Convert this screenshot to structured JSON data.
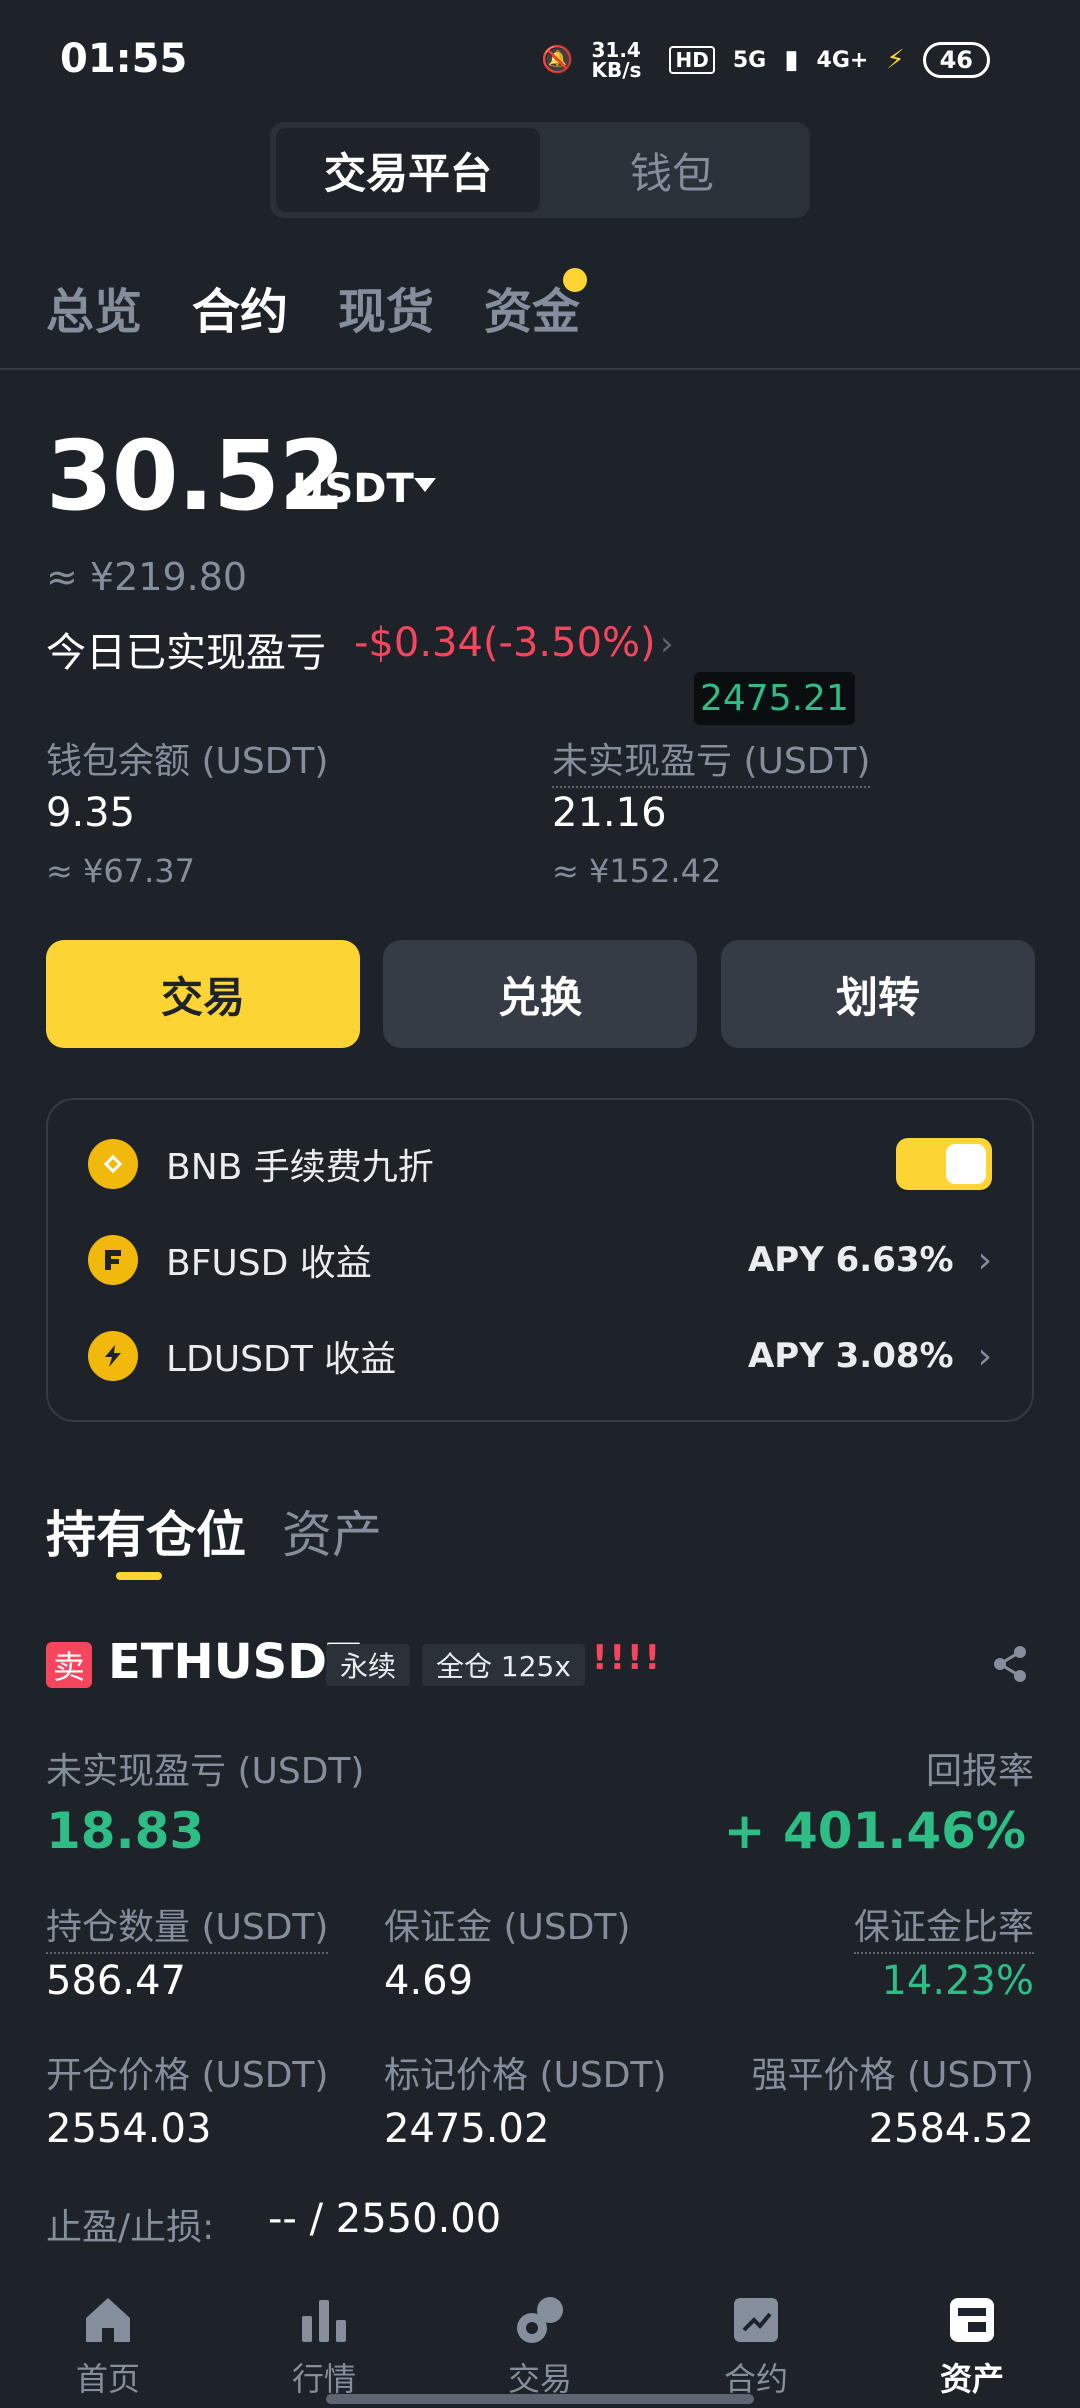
{
  "status": {
    "time": "01:55",
    "speed": "31.4 KB/s",
    "network": "5G",
    "network2": "4G+",
    "battery": "46"
  },
  "segment": {
    "items": [
      "交易平台",
      "钱包"
    ],
    "active": 0
  },
  "tabs": {
    "items": [
      "总览",
      "合约",
      "现货",
      "资金"
    ],
    "active": 1
  },
  "balance": {
    "amount": "30.52",
    "unit": "USDT",
    "approx": "≈ ¥219.80",
    "today_label": "今日已实现盈亏",
    "today_value": "-$0.34(-3.50%)",
    "tooltip": "2475.21"
  },
  "wallet": {
    "label": "钱包余额 (USDT)",
    "value": "9.35",
    "approx": "≈ ¥67.37"
  },
  "unrealized": {
    "label": "未实现盈亏 (USDT)",
    "value": "21.16",
    "approx": "≈ ¥152.42"
  },
  "actions": [
    "交易",
    "兑换",
    "划转"
  ],
  "card": {
    "bnb": {
      "label": "BNB 手续费九折",
      "toggle_on": true
    },
    "bfusd": {
      "label": "BFUSD 收益",
      "apy": "APY 6.63%"
    },
    "ldusdt": {
      "label": "LDUSDT 收益",
      "apy": "APY 3.08%"
    }
  },
  "position_tabs": {
    "items": [
      "持有仓位",
      "资产"
    ],
    "active": 0
  },
  "position": {
    "side": "卖",
    "symbol": "ETHUSDT",
    "type": "永续",
    "margin_mode": "全仓 125x",
    "warning": "!!!!",
    "pnl_label": "未实现盈亏 (USDT)",
    "pnl_value": "18.83",
    "roi_label": "回报率",
    "roi_value": "+ 401.46%",
    "size_label": "持仓数量 (USDT)",
    "size_value": "586.47",
    "margin_label": "保证金 (USDT)",
    "margin_value": "4.69",
    "margin_ratio_label": "保证金比率",
    "margin_ratio_value": "14.23%",
    "entry_label": "开仓价格 (USDT)",
    "entry_value": "2554.03",
    "mark_label": "标记价格 (USDT)",
    "mark_value": "2475.02",
    "liq_label": "强平价格 (USDT)",
    "liq_value": "2584.52",
    "tpsl_label": "止盈/止损:",
    "tpsl_value": "-- / 2550.00"
  },
  "nav": {
    "items": [
      "首页",
      "行情",
      "交易",
      "合约",
      "资产"
    ],
    "active": 4
  }
}
